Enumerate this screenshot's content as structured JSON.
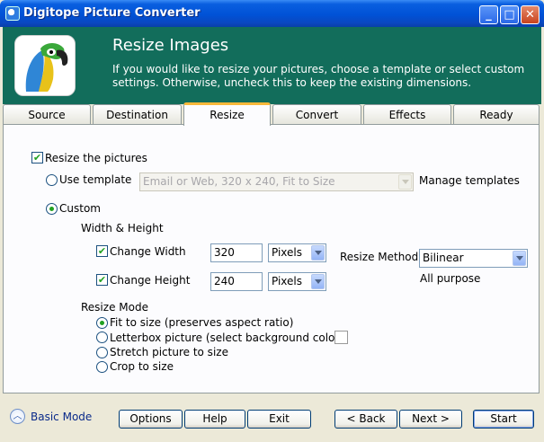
{
  "window": {
    "title": "Digitope Picture Converter",
    "minimize": "_",
    "maximize": "□",
    "close": "✕"
  },
  "header": {
    "title": "Resize Images",
    "description": "If you would like to resize your pictures, choose a template or select custom settings.  Otherwise, uncheck this to keep the existing dimensions."
  },
  "tabs": [
    "Source",
    "Destination",
    "Resize",
    "Convert",
    "Effects",
    "Ready"
  ],
  "active_tab": "Resize",
  "resize": {
    "enable_label": "Resize the pictures",
    "enable_checked": true,
    "use_template_label": "Use template",
    "template_value": "Email or Web, 320 x 240, Fit to Size",
    "manage_templates": "Manage templates",
    "custom_label": "Custom",
    "mode_selected": "custom",
    "width_height_label": "Width & Height",
    "change_width_label": "Change Width",
    "change_width_checked": true,
    "width_value": "320",
    "width_unit": "Pixels",
    "change_height_label": "Change Height",
    "change_height_checked": true,
    "height_value": "240",
    "height_unit": "Pixels",
    "method_label": "Resize Method:",
    "method_value": "Bilinear",
    "method_desc": "All purpose",
    "resize_mode_label": "Resize Mode",
    "modes": [
      {
        "label": "Fit to size (preserves aspect ratio)",
        "selected": true
      },
      {
        "label": "Letterbox picture (select background color)",
        "selected": false
      },
      {
        "label": "Stretch picture to size",
        "selected": false
      },
      {
        "label": "Crop to size",
        "selected": false
      }
    ]
  },
  "footer": {
    "basic_mode": "Basic Mode",
    "options": "Options",
    "help": "Help",
    "exit": "Exit",
    "back": "< Back",
    "next": "Next >",
    "start": "Start"
  },
  "colors": {
    "header_bg": "#126d5b",
    "titlebar": "#0052d6",
    "active_tab_accent": "#f9b83a",
    "check": "#21a121"
  },
  "icons": {
    "app": "app-icon",
    "logo": "parrot-logo",
    "basic_mode": "chevron-up-icon"
  }
}
